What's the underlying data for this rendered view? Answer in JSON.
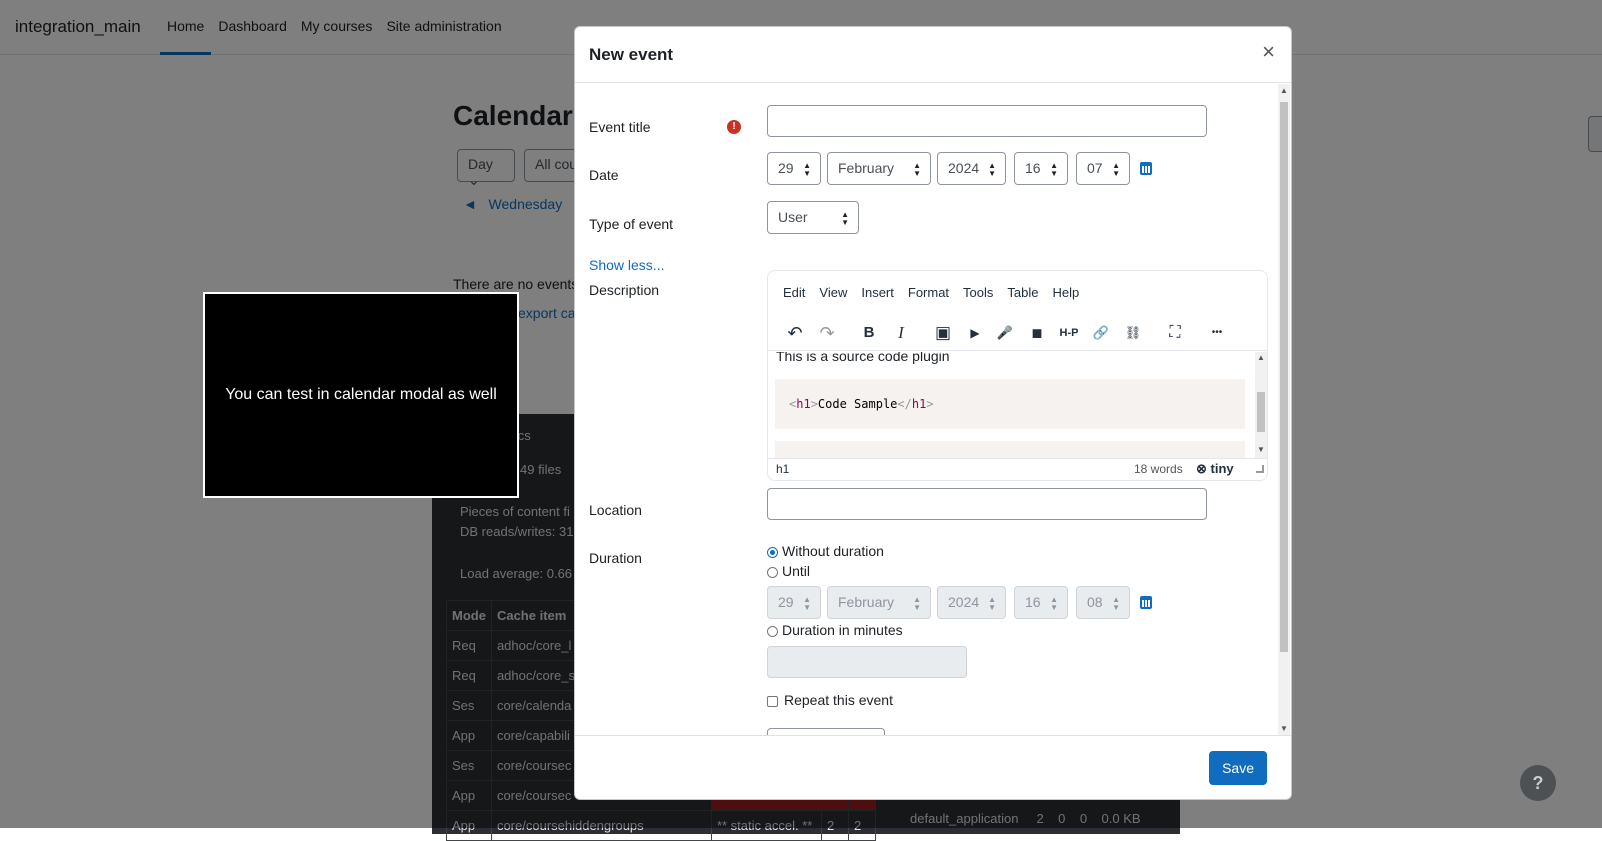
{
  "site": {
    "brand": "integration_main",
    "nav": [
      "Home",
      "Dashboard",
      "My courses",
      "Site administration"
    ]
  },
  "calendar": {
    "title": "Calendar",
    "view_select": "Day",
    "course_select": "All cou",
    "prev_day": "Wednesday",
    "no_events": "There are no events",
    "export_link": "export ca"
  },
  "perf": {
    "secs": "secs",
    "files": "49 files",
    "pieces": "Pieces of content fi",
    "db": "DB reads/writes: 31",
    "load": "Load average: 0.66",
    "headers": [
      "Mode",
      "Cache item"
    ],
    "rows": [
      [
        "Req",
        "adhoc/core_l"
      ],
      [
        "Req",
        "adhoc/core_s"
      ],
      [
        "Ses",
        "core/calenda"
      ],
      [
        "App",
        "core/capabili"
      ],
      [
        "Ses",
        "core/coursec"
      ],
      [
        "App",
        "core/coursec"
      ],
      [
        "App",
        "core/coursehiddengroups"
      ]
    ],
    "last_row_extra": [
      "** static accel. **",
      "2",
      "2",
      "default_application",
      "2",
      "0",
      "0",
      "0.0 KB"
    ]
  },
  "video_tip": "You can test in calendar modal as well",
  "help_icon": "?",
  "modal": {
    "title": "New event",
    "close": "×",
    "event_title_label": "Event title",
    "event_title_value": "",
    "required_icon": "!",
    "date_label": "Date",
    "date": {
      "day": "29",
      "month": "February",
      "year": "2024",
      "hour": "16",
      "minute": "07"
    },
    "type_label": "Type of event",
    "type_value": "User",
    "show_less": "Show less...",
    "description_label": "Description",
    "editor": {
      "menus": [
        "Edit",
        "View",
        "Insert",
        "Format",
        "Tools",
        "Table",
        "Help"
      ],
      "toolbar_icons": [
        "undo-icon",
        "redo-icon",
        "bold-icon",
        "italic-icon",
        "image-icon",
        "media-icon",
        "record-audio-icon",
        "record-video-icon",
        "h5p-icon",
        "link-icon",
        "unlink-icon",
        "fullscreen-icon",
        "more-icon"
      ],
      "toolbar_glyphs": {
        "undo": "↶",
        "redo": "↷",
        "bold": "B",
        "italic": "I",
        "image": "▣",
        "media": "▶",
        "audio": "🎤",
        "video": "■",
        "h5p": "H-P",
        "link": "🔗",
        "unlink": "⛓",
        "fullscreen": "⛶",
        "more": "•••"
      },
      "content_line": "This is a source code plugin",
      "code_open": "<",
      "code_tag": "h1",
      "code_close_bracket": ">",
      "code_text": "Code Sample",
      "code_end_open": "</",
      "status_path": "h1",
      "word_count": "18 words",
      "logo": "tiny"
    },
    "location_label": "Location",
    "location_value": "",
    "duration_label": "Duration",
    "duration_options": [
      "Without duration",
      "Until",
      "Duration in minutes"
    ],
    "until_date": {
      "day": "29",
      "month": "February",
      "year": "2024",
      "hour": "16",
      "minute": "08"
    },
    "duration_minutes": "",
    "repeat_label": "Repeat this event",
    "save_label": "Save"
  },
  "colors": {
    "primary": "#0f6cbf",
    "danger": "#ca3120"
  }
}
